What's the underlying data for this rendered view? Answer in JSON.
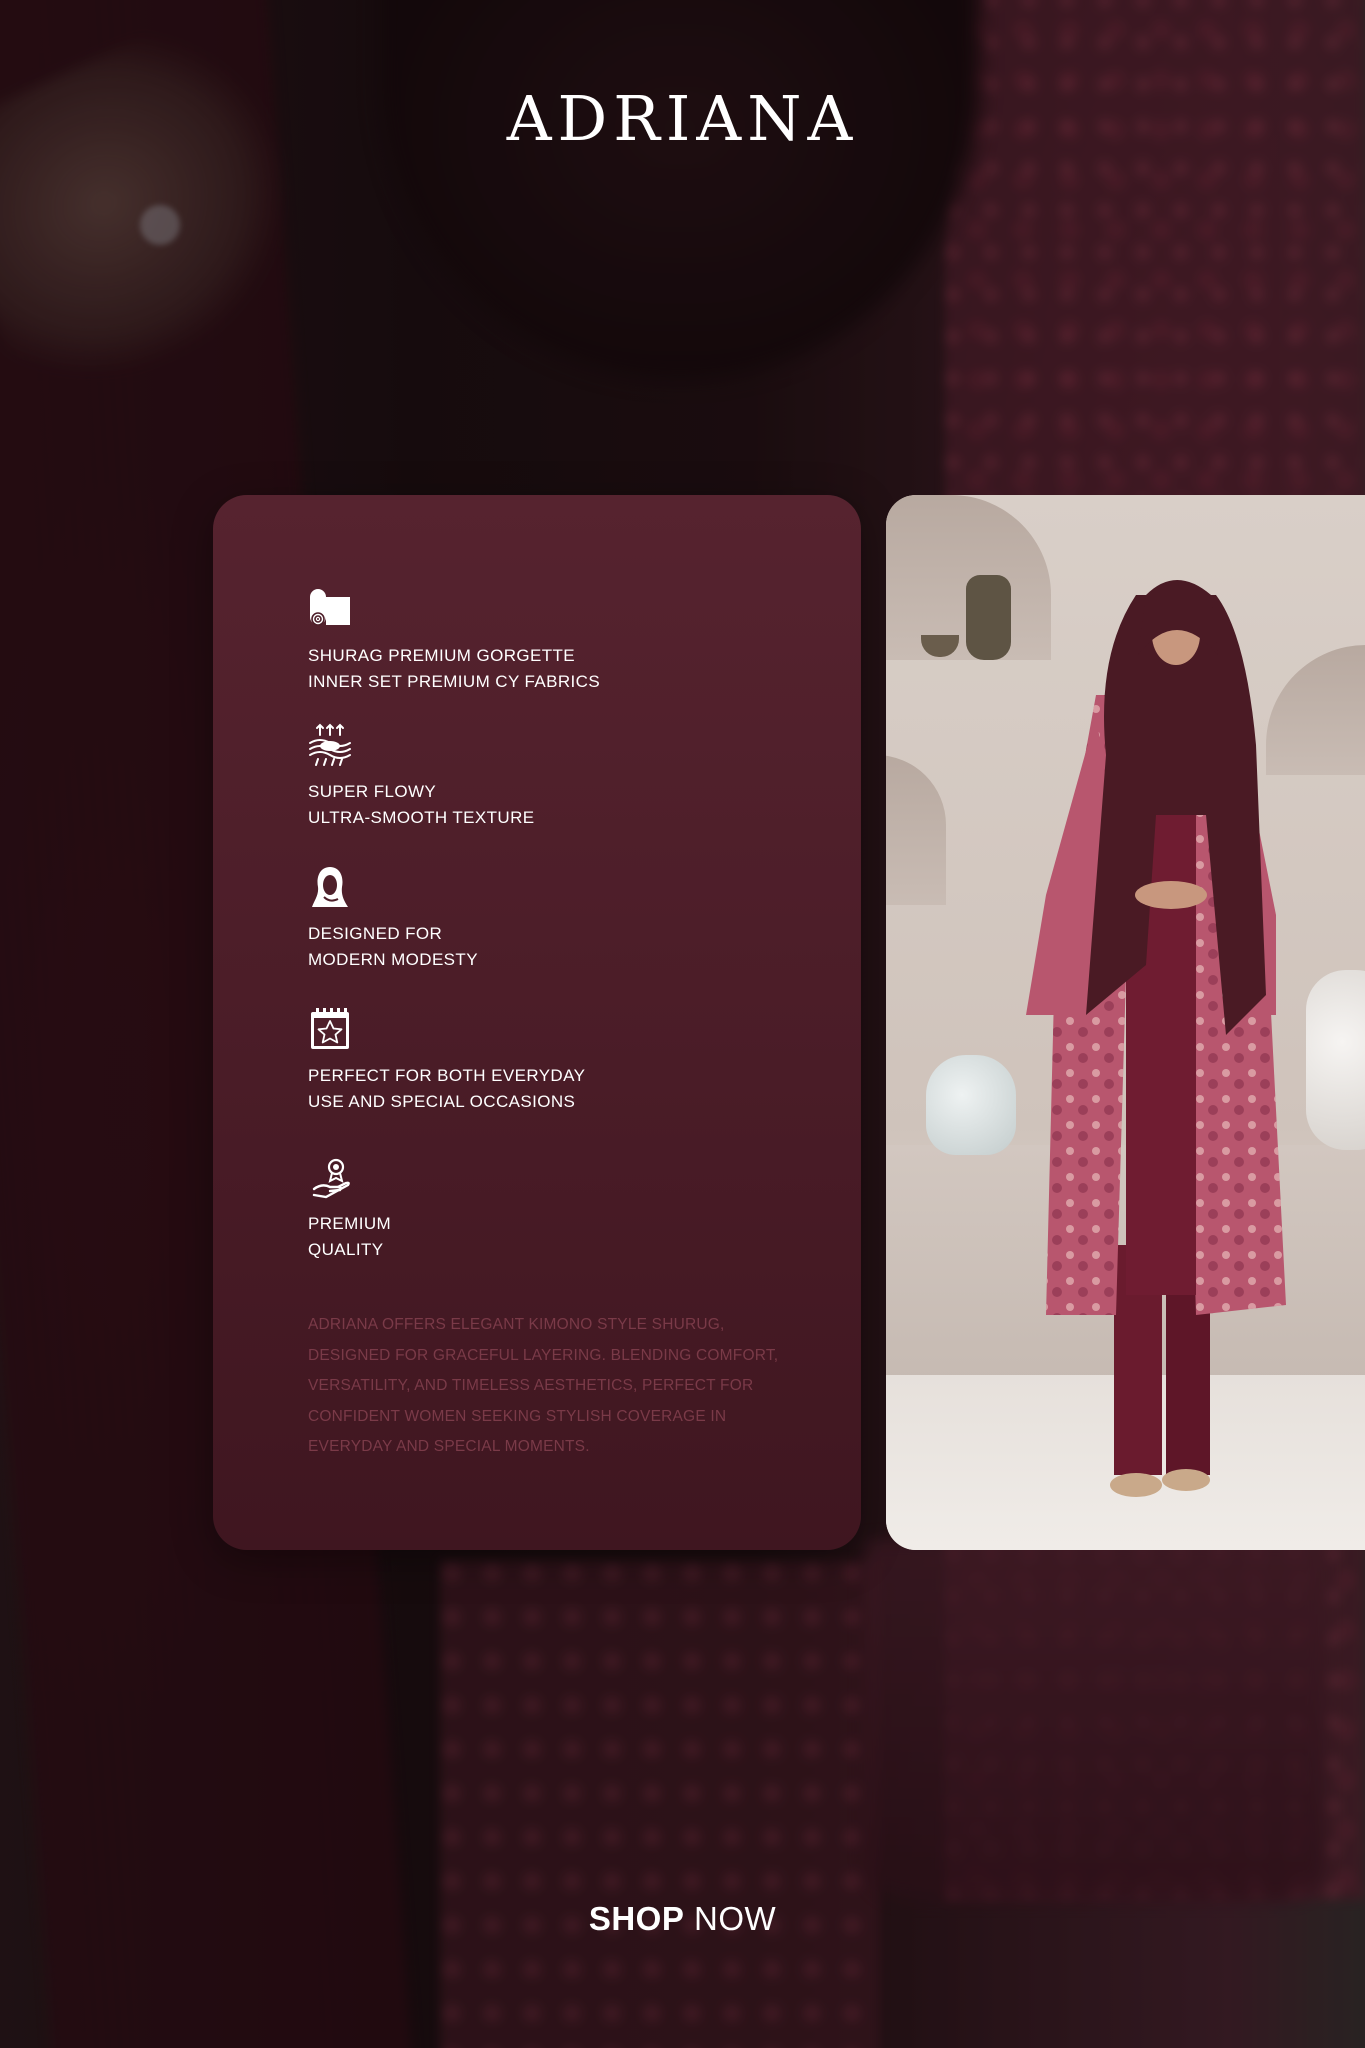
{
  "brand": {
    "logo_text": "ADRIANA"
  },
  "features": [
    {
      "icon": "fabric-roll-icon",
      "lines": [
        "SHURAG PREMIUM GORGETTE",
        "INNER SET PREMIUM CY FABRICS"
      ]
    },
    {
      "icon": "flowy-texture-icon",
      "lines": [
        "SUPER FLOWY",
        "ULTRA-SMOOTH TEXTURE"
      ]
    },
    {
      "icon": "hijab-icon",
      "lines": [
        "DESIGNED FOR",
        "MODERN MODESTY"
      ]
    },
    {
      "icon": "calendar-star-icon",
      "lines": [
        "PERFECT FOR BOTH EVERYDAY",
        "USE AND SPECIAL OCCASIONS"
      ]
    },
    {
      "icon": "premium-hand-icon",
      "lines": [
        "PREMIUM",
        "QUALITY"
      ]
    }
  ],
  "description": "ADRIANA OFFERS ELEGANT KIMONO STYLE SHURUG, DESIGNED FOR GRACEFUL LAYERING. BLENDING COMFORT, VERSATILITY, AND TIMELESS AESTHETICS, PERFECT FOR CONFIDENT WOMEN SEEKING STYLISH COVERAGE IN EVERYDAY AND SPECIAL MOMENTS.",
  "cta": {
    "bold": "SHOP",
    "light": "NOW"
  },
  "colors": {
    "card": "#4e1f2a",
    "description_text": "#7a3a48",
    "text": "#ffffff"
  }
}
